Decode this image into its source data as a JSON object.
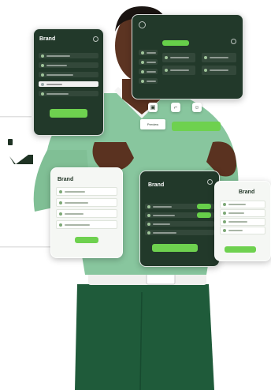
{
  "panels": {
    "top_left": {
      "brand": "Brand"
    },
    "mid_left": {
      "brand": "Brand"
    },
    "center": {
      "brand": "Brand"
    },
    "right": {
      "brand": "Brand"
    },
    "top_center": {}
  },
  "floating_chip": {
    "label": "Preview"
  },
  "colors": {
    "panel_dark": "#22392a",
    "accent_green": "#6ed14f",
    "sweater": "#88c69e",
    "pants": "#1e5a38",
    "skin": "#5a3220",
    "shirt_collar": "#f4f4f4"
  }
}
